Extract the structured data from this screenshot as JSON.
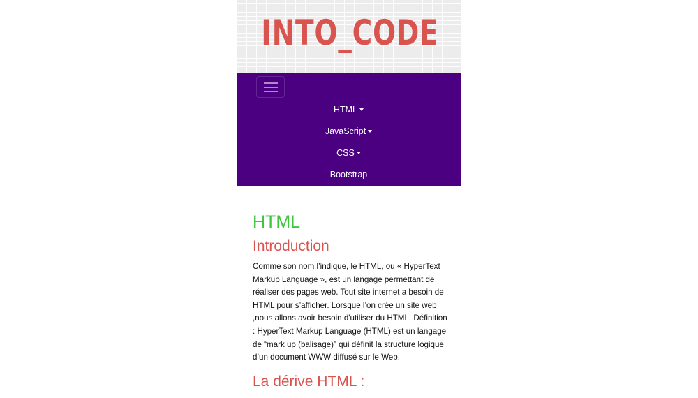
{
  "header": {
    "logo_text": "INTO_CODE"
  },
  "navbar": {
    "toggler_icon": "hamburger-icon",
    "items": [
      {
        "label": "HTML",
        "dropdown": true
      },
      {
        "label": "JavaScript",
        "dropdown": true
      },
      {
        "label": "CSS",
        "dropdown": true
      },
      {
        "label": "Bootstrap",
        "dropdown": false
      }
    ]
  },
  "content": {
    "title": "HTML",
    "intro_heading": "Introduction",
    "intro_paragraph": "Comme son nom l’indique, le HTML, ou « HyperText Markup Language », est un langage permettant de réaliser des pages web. Tout site internet a besoin de HTML pour s’afficher. Lorsque l’on crée un site web ,nous allons avoir besoin d'utiliser du HTML. Définition : HyperText Markup Language (HTML) est un langage de “mark up (balisage)” qui définit la structure logique d’un document WWW diffusé sur le Web.",
    "derive_heading": "La dérive HTML :"
  },
  "colors": {
    "nav_background": "#4b0082",
    "logo": "#d9534f",
    "title_green": "#3ec63e",
    "heading_red": "#d9534f"
  }
}
